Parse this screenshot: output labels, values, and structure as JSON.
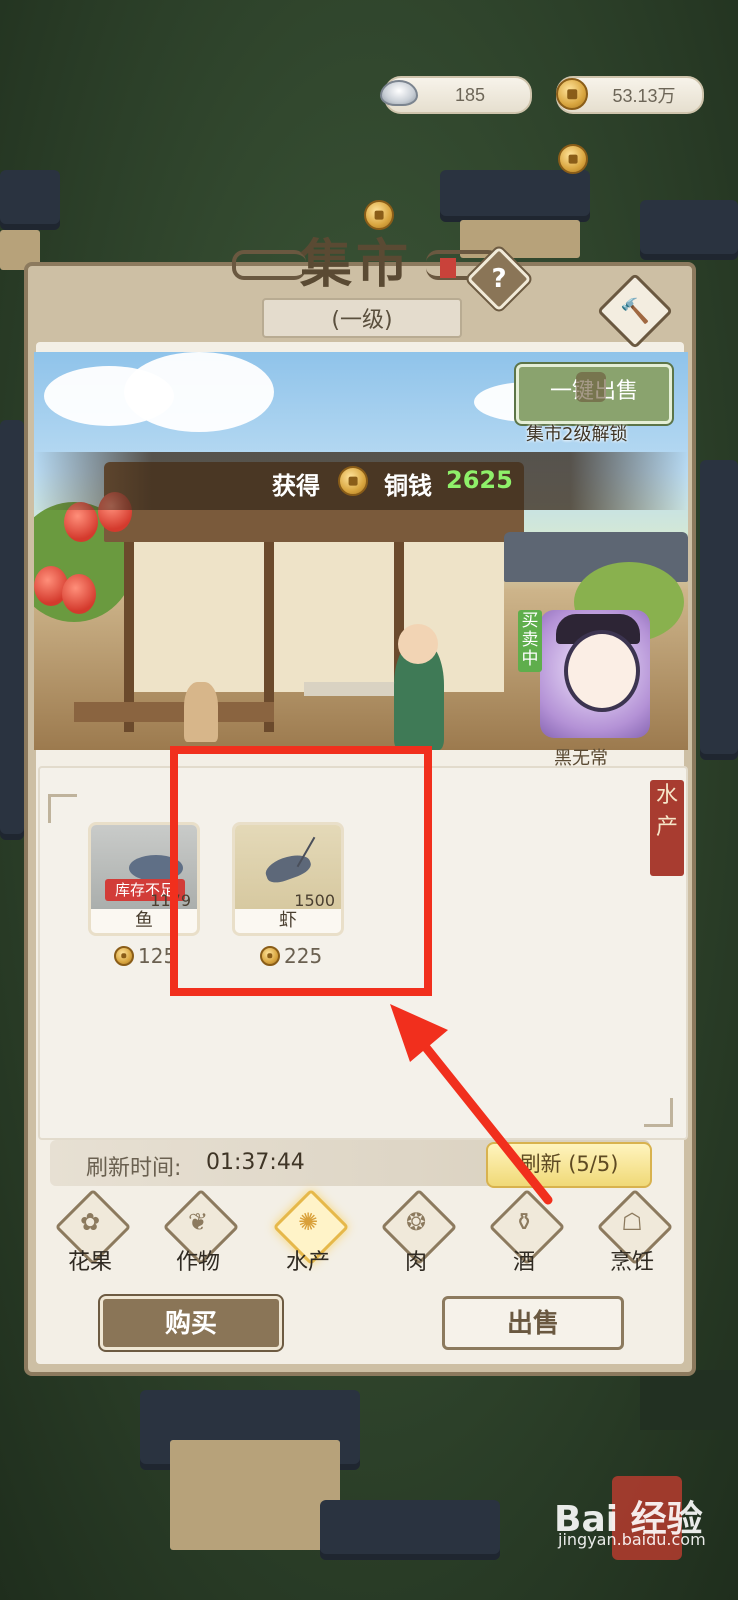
{
  "currency": {
    "silver": "185",
    "copper": "53.13万"
  },
  "panel": {
    "title": "集市",
    "level": "(一级)",
    "help": "?"
  },
  "banner": {
    "prefix": "获得",
    "currency": "铜钱",
    "amount": "2625"
  },
  "sell_all": {
    "label": "一键出售",
    "unlock_hint": "集市2级解锁"
  },
  "trader": {
    "status": "买卖中",
    "name": "黑无常"
  },
  "category_seal": "水产",
  "items": [
    {
      "name": "鱼",
      "stock": "1179",
      "price": "125",
      "status": "库存不足"
    },
    {
      "name": "虾",
      "stock": "1500",
      "price": "225"
    }
  ],
  "refresh": {
    "label": "刷新时间:",
    "time": "01:37:44",
    "button": "刷新 (5/5)"
  },
  "categories": [
    {
      "label": "花果",
      "icon": "fruit-icon"
    },
    {
      "label": "作物",
      "icon": "grain-icon"
    },
    {
      "label": "水产",
      "icon": "seafood-icon",
      "active": true
    },
    {
      "label": "肉",
      "icon": "meat-icon"
    },
    {
      "label": "酒",
      "icon": "wine-icon"
    },
    {
      "label": "烹饪",
      "icon": "cooking-icon"
    }
  ],
  "buttons": {
    "buy": "购买",
    "sell": "出售"
  },
  "watermark": {
    "logo": "Bai 经验",
    "url": "jingyan.baidu.com"
  },
  "colors": {
    "highlight": "#f12f1d",
    "accent_green": "#8ff06a",
    "panel_brown": "#8c7a5e"
  }
}
